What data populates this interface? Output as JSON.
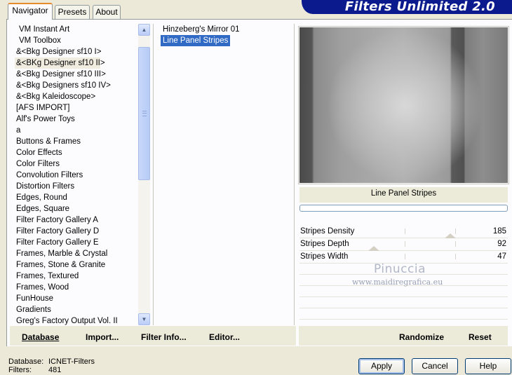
{
  "banner": {
    "title": "Filters Unlimited 2.0"
  },
  "tabs": [
    {
      "label": "Navigator",
      "active": true
    },
    {
      "label": "Presets",
      "active": false
    },
    {
      "label": "About",
      "active": false
    }
  ],
  "categories": [
    "VM Instant Art",
    "VM Toolbox",
    "&<Bkg Designer sf10 I>",
    "&<BKg Designer sf10 II>",
    "&<Bkg Designer sf10 III>",
    "&<Bkg Designers sf10 IV>",
    "&<Bkg Kaleidoscope>",
    "[AFS IMPORT]",
    "Alf's Power Toys",
    "a",
    "Buttons & Frames",
    "Color Effects",
    "Color Filters",
    "Convolution Filters",
    "Distortion Filters",
    "Edges, Round",
    "Edges, Square",
    "Filter Factory Gallery A",
    "Filter Factory Gallery D",
    "Filter Factory Gallery E",
    "Frames, Marble & Crystal",
    "Frames, Stone & Granite",
    "Frames, Textured",
    "Frames, Wood",
    "FunHouse",
    "Gradients",
    "Greg's Factory Output Vol. II"
  ],
  "selected_category_index": 3,
  "filters": [
    "Hinzeberg's Mirror 01",
    "Line Panel Stripes"
  ],
  "selected_filter_index": 1,
  "filter_title": "Line Panel Stripes",
  "params": [
    {
      "label": "Stripes Density",
      "value": "185"
    },
    {
      "label": "Stripes Depth",
      "value": "92"
    },
    {
      "label": "Stripes Width",
      "value": "47"
    }
  ],
  "watermark": {
    "name": "Pinuccia",
    "url": "www.maidiregrafica.eu"
  },
  "bottom_buttons": {
    "database": "Database",
    "import": "Import...",
    "filter_info": "Filter Info...",
    "editor": "Editor...",
    "randomize": "Randomize",
    "reset": "Reset"
  },
  "status": {
    "database_label": "Database:",
    "database_value": "ICNET-Filters",
    "filters_label": "Filters:",
    "filters_value": "481"
  },
  "dialog_buttons": {
    "apply": "Apply",
    "cancel": "Cancel",
    "help": "Help"
  }
}
